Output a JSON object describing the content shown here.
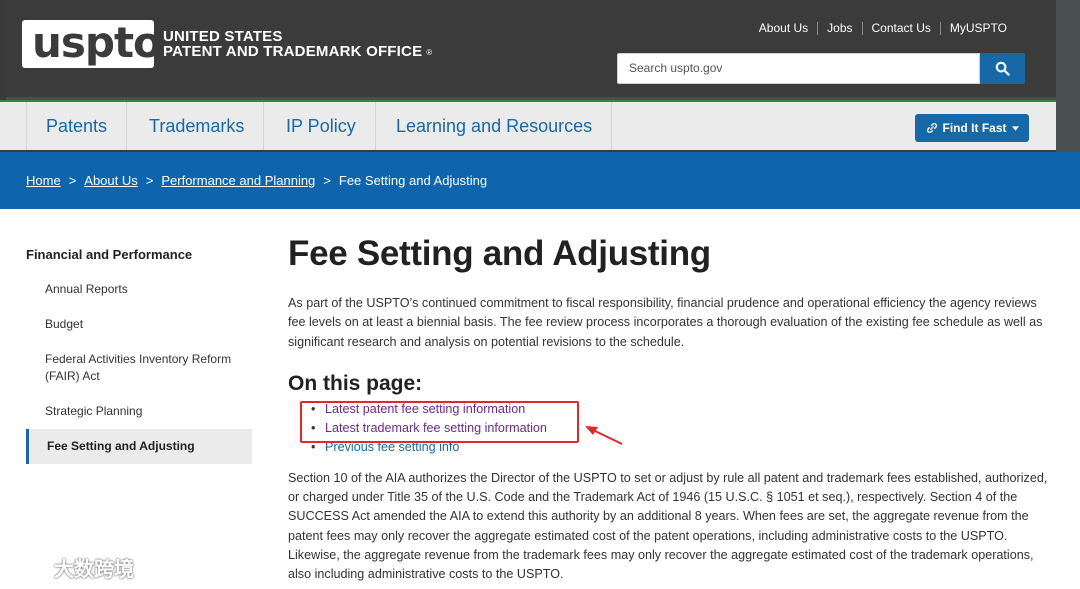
{
  "header": {
    "logo_text": "uspto",
    "agency_line1": "UNITED STATES",
    "agency_line2": "PATENT AND TRADEMARK OFFICE",
    "registered_mark": "®",
    "utility_links": [
      "About Us",
      "Jobs",
      "Contact Us",
      "MyUSPTO"
    ],
    "search_placeholder": "Search uspto.gov",
    "search_icon": "search-icon"
  },
  "main_nav": {
    "items": [
      "Patents",
      "Trademarks",
      "IP Policy",
      "Learning and Resources"
    ],
    "find_it_fast": "Find It Fast",
    "find_it_fast_icon": "link-icon"
  },
  "breadcrumb": {
    "items": [
      "Home",
      "About Us",
      "Performance and Planning"
    ],
    "separator": ">",
    "current": "Fee Setting and Adjusting"
  },
  "sidebar": {
    "heading": "Financial and Performance",
    "items": [
      "Annual Reports",
      "Budget",
      "Federal Activities Inventory Reform (FAIR) Act",
      "Strategic Planning",
      "Fee Setting and Adjusting"
    ],
    "active_item": "Fee Setting and Adjusting"
  },
  "content": {
    "title": "Fee Setting and Adjusting",
    "intro": "As part of the USPTO’s continued commitment to fiscal responsibility, financial prudence and operational efficiency the agency reviews fee levels on at least a biennial basis.  The fee review process incorporates a thorough evaluation of the existing fee schedule as well as significant research and analysis on potential revisions to the schedule.",
    "on_this_page_heading": "On this page:",
    "toc": [
      "Latest patent fee setting information",
      "Latest trademark fee setting information",
      "Previous fee setting info"
    ],
    "body": "Section 10 of the AIA authorizes the Director of the USPTO to set or adjust by rule all patent and trademark fees established, authorized, or charged under Title 35 of the U.S. Code and the Trademark Act of 1946 (15 U.S.C. § 1051 et seq.), respectively. Section 4 of the SUCCESS Act amended the AIA to extend this authority by an additional 8 years. When fees are set, the aggregate revenue from the patent fees may only recover the aggregate estimated cost of the patent operations, including administrative costs to the USPTO. Likewise, the aggregate revenue from the trademark fees may only recover the aggregate estimated cost of the trademark operations, also including administrative costs to the USPTO."
  },
  "watermark": {
    "text": "大数跨境"
  },
  "colors": {
    "header_bg": "#3b3b3b",
    "brand_blue": "#1669a6",
    "breadcrumb_bg": "#0e64ad",
    "visited_link": "#6c2a8c",
    "annotation_red": "#e02a2a",
    "nav_accent_green": "#2d8a3a"
  }
}
